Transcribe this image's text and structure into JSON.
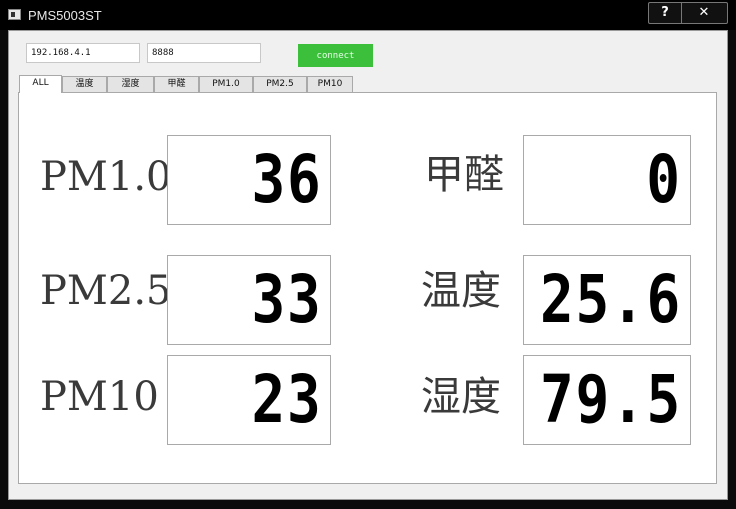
{
  "window": {
    "title": "PMS5003ST",
    "help_label": "?",
    "close_label": "✕"
  },
  "connection": {
    "ip": "192.168.4.1",
    "port": "8888",
    "connect_label": "connect"
  },
  "tabs": [
    {
      "label": "ALL",
      "active": true
    },
    {
      "label": "温度"
    },
    {
      "label": "湿度"
    },
    {
      "label": "甲醛"
    },
    {
      "label": "PM1.0"
    },
    {
      "label": "PM2.5"
    },
    {
      "label": "PM10"
    }
  ],
  "readings": [
    {
      "label": "PM1.0",
      "value": "36"
    },
    {
      "label": "PM2.5",
      "value": "33"
    },
    {
      "label": "PM10",
      "value": "23"
    },
    {
      "label": "甲醛",
      "value": "0"
    },
    {
      "label": "温度",
      "value": "25.6"
    },
    {
      "label": "湿度",
      "value": "79.5"
    }
  ]
}
